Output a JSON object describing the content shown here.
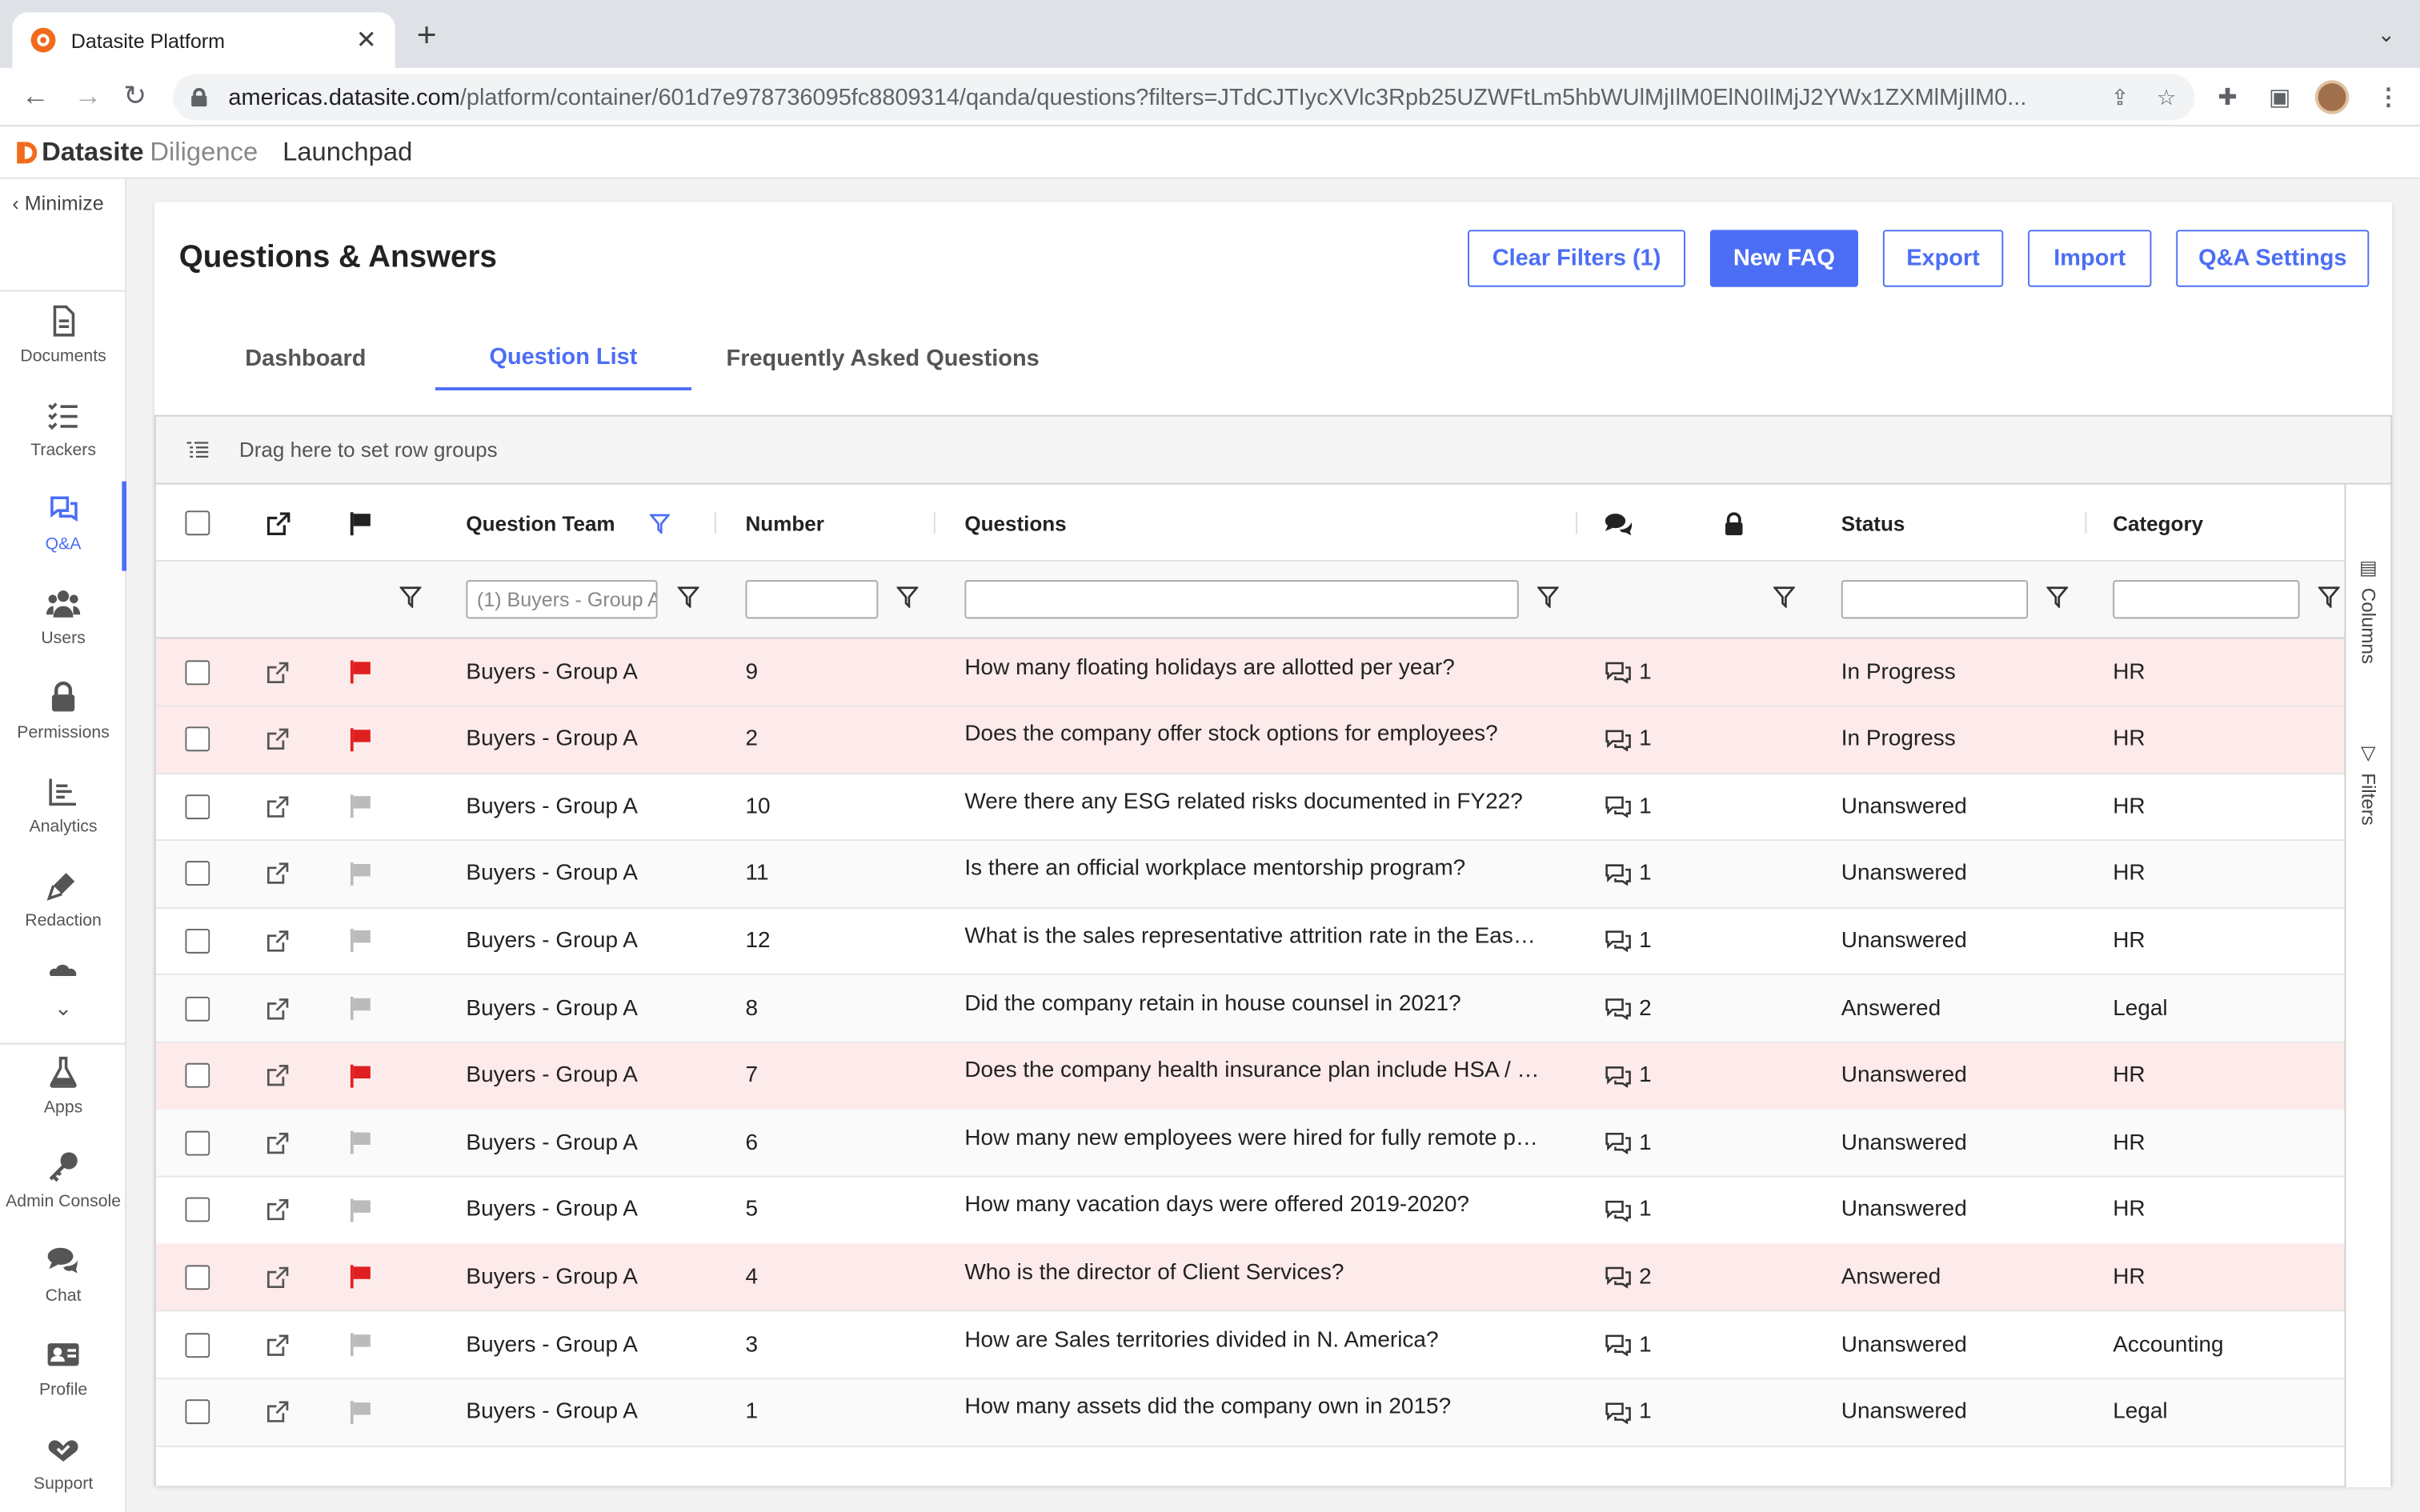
{
  "browser": {
    "tab_title": "Datasite Platform",
    "url_host": "americas.datasite.com",
    "url_path": "/platform/container/601d7e978736095fc8809314/qanda/questions?filters=JTdCJTIycXVlc3Rpb25UZWFtLm5hbWUlMjIlM0ElN0IlMjJ2YWx1ZXMlMjIlM0..."
  },
  "app": {
    "brand": "Datasite",
    "product": "Diligence",
    "launchpad": "Launchpad"
  },
  "nav": {
    "minimize": "Minimize",
    "items": [
      {
        "label": "Documents",
        "icon": "document-icon"
      },
      {
        "label": "Trackers",
        "icon": "checklist-icon"
      },
      {
        "label": "Q&A",
        "icon": "chat-bubbles-icon",
        "active": true
      },
      {
        "label": "Users",
        "icon": "users-icon"
      },
      {
        "label": "Permissions",
        "icon": "lock-icon"
      },
      {
        "label": "Analytics",
        "icon": "bar-chart-icon"
      },
      {
        "label": "Redaction",
        "icon": "marker-icon"
      },
      {
        "label": "Apps",
        "icon": "flask-icon"
      },
      {
        "label": "Admin Console",
        "icon": "key-icon"
      },
      {
        "label": "Chat",
        "icon": "chat-icon"
      },
      {
        "label": "Profile",
        "icon": "id-card-icon"
      },
      {
        "label": "Support",
        "icon": "support-icon"
      }
    ]
  },
  "page": {
    "title": "Questions & Answers",
    "buttons": {
      "clear_filters": "Clear Filters (1)",
      "new_faq": "New FAQ",
      "export": "Export",
      "import": "Import",
      "settings": "Q&A Settings"
    },
    "tabs": [
      "Dashboard",
      "Question List",
      "Frequently Asked Questions"
    ],
    "active_tab": "Question List"
  },
  "grid": {
    "row_group_hint": "Drag here to set row groups",
    "columns": {
      "team": "Question Team",
      "number": "Number",
      "questions": "Questions",
      "status": "Status",
      "category": "Category"
    },
    "filters": {
      "team_value": "(1) Buyers - Group A"
    },
    "side_panel": {
      "columns": "Columns",
      "filters": "Filters"
    },
    "rows": [
      {
        "flag": "red",
        "team": "Buyers - Group A",
        "number": "9",
        "question": "How many floating holidays are allotted per year?",
        "comments": "1",
        "status": "In Progress",
        "category": "HR"
      },
      {
        "flag": "red",
        "team": "Buyers - Group A",
        "number": "2",
        "question": "Does the company offer stock options for employees?",
        "comments": "1",
        "status": "In Progress",
        "category": "HR"
      },
      {
        "flag": "grey",
        "team": "Buyers - Group A",
        "number": "10",
        "question": "Were there any ESG related risks documented in FY22?",
        "comments": "1",
        "status": "Unanswered",
        "category": "HR"
      },
      {
        "flag": "grey",
        "team": "Buyers - Group A",
        "number": "11",
        "question": "Is there an official workplace mentorship program?",
        "comments": "1",
        "status": "Unanswered",
        "category": "HR"
      },
      {
        "flag": "grey",
        "team": "Buyers - Group A",
        "number": "12",
        "question": "What is the sales representative attrition rate in the Eas…",
        "comments": "1",
        "status": "Unanswered",
        "category": "HR"
      },
      {
        "flag": "grey",
        "team": "Buyers - Group A",
        "number": "8",
        "question": "Did the company retain in house counsel in 2021?",
        "comments": "2",
        "status": "Answered",
        "category": "Legal"
      },
      {
        "flag": "red",
        "team": "Buyers - Group A",
        "number": "7",
        "question": "Does the company health insurance plan include HSA / …",
        "comments": "1",
        "status": "Unanswered",
        "category": "HR"
      },
      {
        "flag": "grey",
        "team": "Buyers - Group A",
        "number": "6",
        "question": "How many new employees were hired for fully remote p…",
        "comments": "1",
        "status": "Unanswered",
        "category": "HR"
      },
      {
        "flag": "grey",
        "team": "Buyers - Group A",
        "number": "5",
        "question": "How many vacation days were offered 2019-2020?",
        "comments": "1",
        "status": "Unanswered",
        "category": "HR"
      },
      {
        "flag": "red",
        "team": "Buyers - Group A",
        "number": "4",
        "question": "Who is the director of Client Services?",
        "comments": "2",
        "status": "Answered",
        "category": "HR"
      },
      {
        "flag": "grey",
        "team": "Buyers - Group A",
        "number": "3",
        "question": "How are Sales territories divided in N. America?",
        "comments": "1",
        "status": "Unanswered",
        "category": "Accounting"
      },
      {
        "flag": "grey",
        "team": "Buyers - Group A",
        "number": "1",
        "question": "How many assets did the company own in 2015?",
        "comments": "1",
        "status": "Unanswered",
        "category": "Legal"
      }
    ]
  },
  "colors": {
    "accent": "#4c6ef5",
    "flagged_row": "#fdeaea",
    "flag_red": "#e02020",
    "brand_orange": "#f26a1b"
  }
}
